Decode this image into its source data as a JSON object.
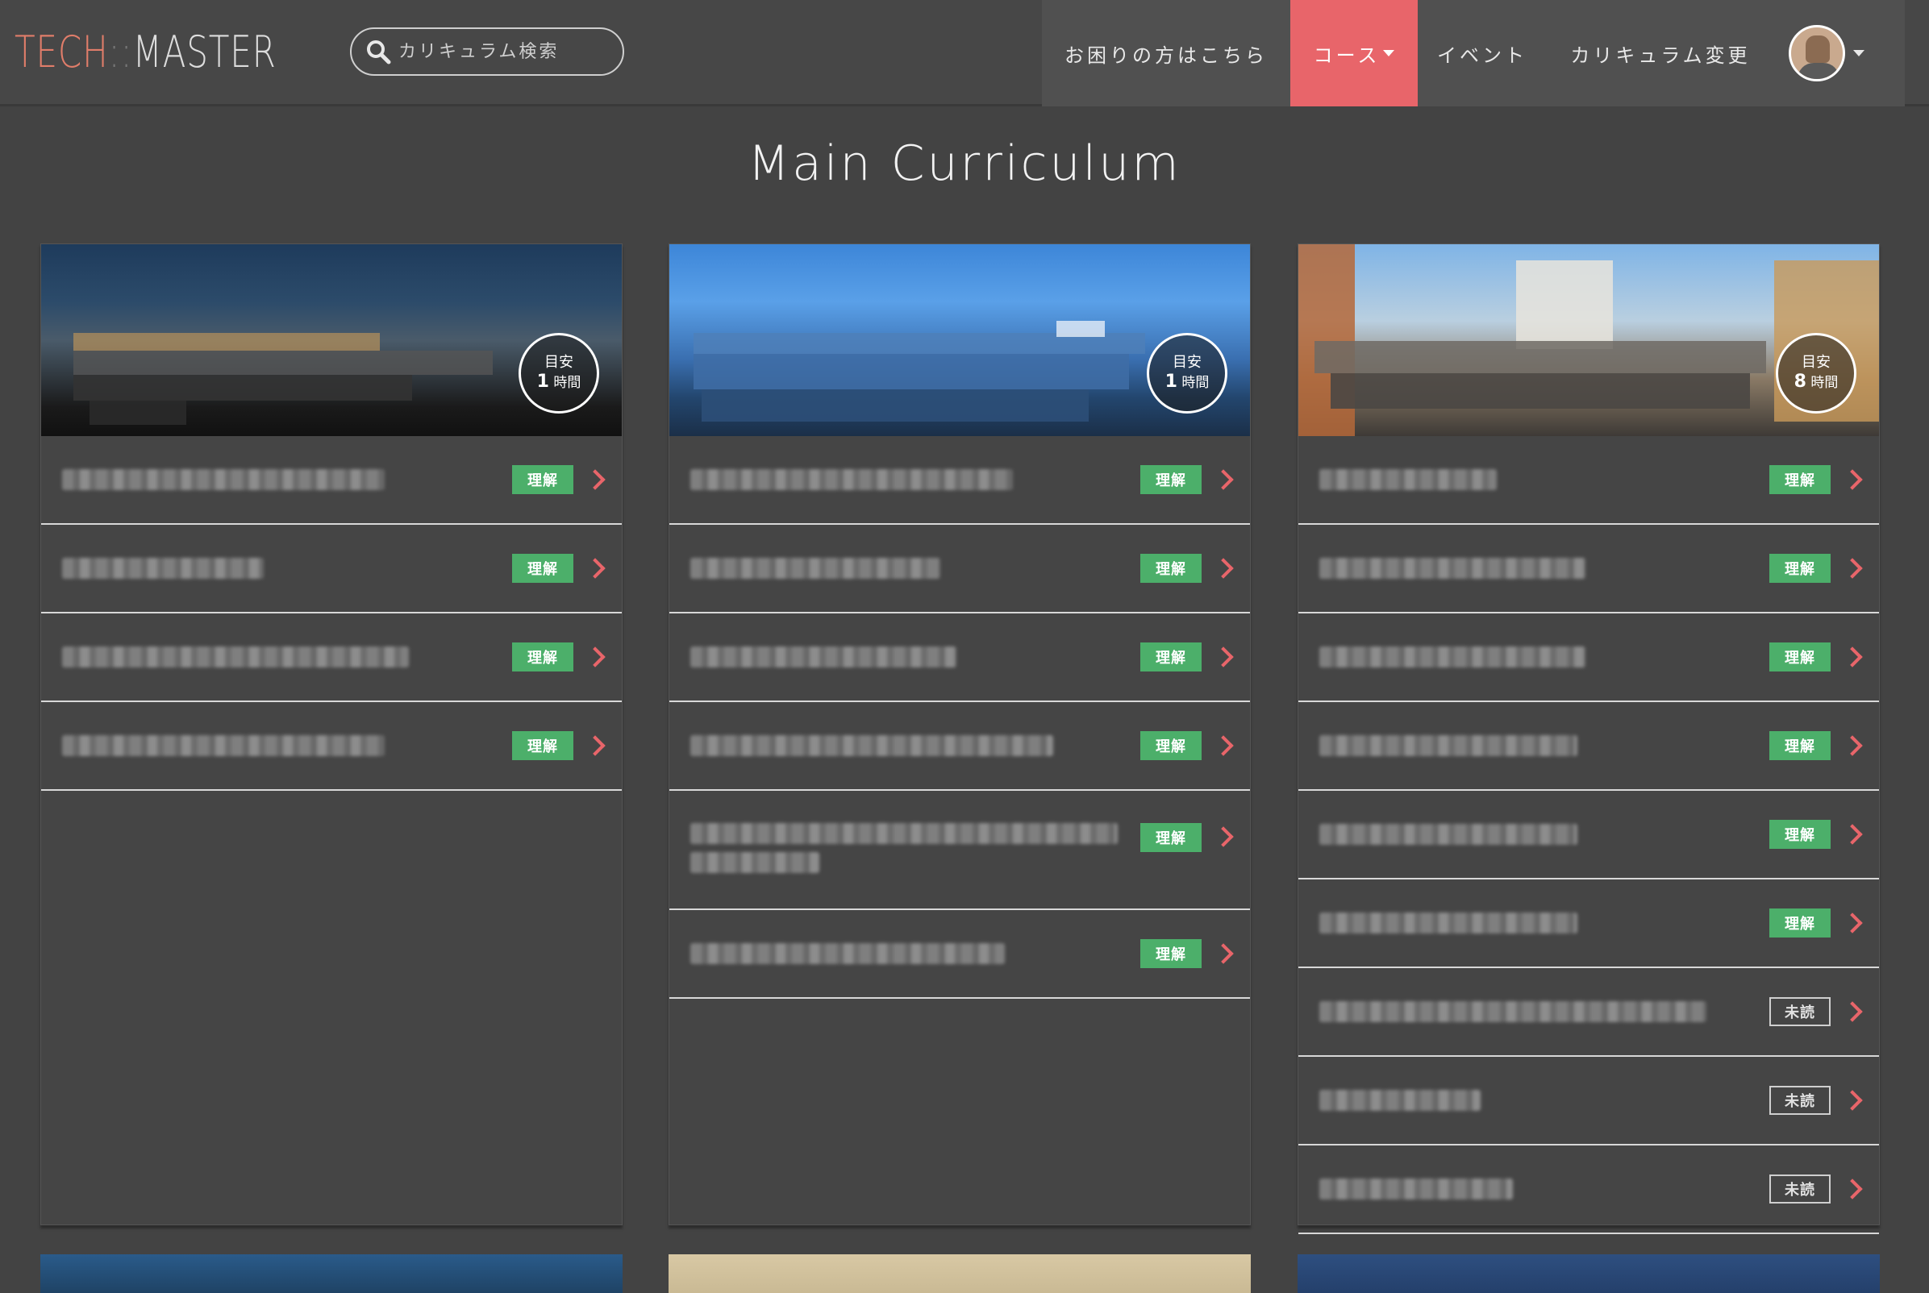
{
  "header": {
    "logo_tech": "TECH",
    "logo_sep": "::",
    "logo_master": "MASTER",
    "search_placeholder": "カリキュラム検索",
    "nav": [
      {
        "label": "お困りの方はこちら"
      },
      {
        "label": "コース"
      },
      {
        "label": "イベント"
      },
      {
        "label": "カリキュラム変更"
      }
    ]
  },
  "page_title": "Main Curriculum",
  "courses": [
    {
      "badge_top": "目安",
      "badge_num": "1",
      "badge_unit": "時間",
      "lessons": [
        {
          "status": "理解"
        },
        {
          "status": "理解"
        },
        {
          "status": "理解"
        },
        {
          "status": "理解"
        }
      ]
    },
    {
      "badge_top": "目安",
      "badge_num": "1",
      "badge_unit": "時間",
      "lessons": [
        {
          "status": "理解"
        },
        {
          "status": "理解"
        },
        {
          "status": "理解"
        },
        {
          "status": "理解"
        },
        {
          "status": "理解"
        },
        {
          "status": "理解"
        }
      ]
    },
    {
      "badge_top": "目安",
      "badge_num": "8",
      "badge_unit": "時間",
      "lessons": [
        {
          "status": "理解"
        },
        {
          "status": "理解"
        },
        {
          "status": "理解"
        },
        {
          "status": "理解"
        },
        {
          "status": "理解"
        },
        {
          "status": "理解"
        },
        {
          "status": "未読"
        },
        {
          "status": "未読"
        },
        {
          "status": "未読"
        }
      ]
    }
  ],
  "colors": {
    "accent": "#e8656a",
    "understood": "#4caf6a",
    "background": "#434343"
  }
}
